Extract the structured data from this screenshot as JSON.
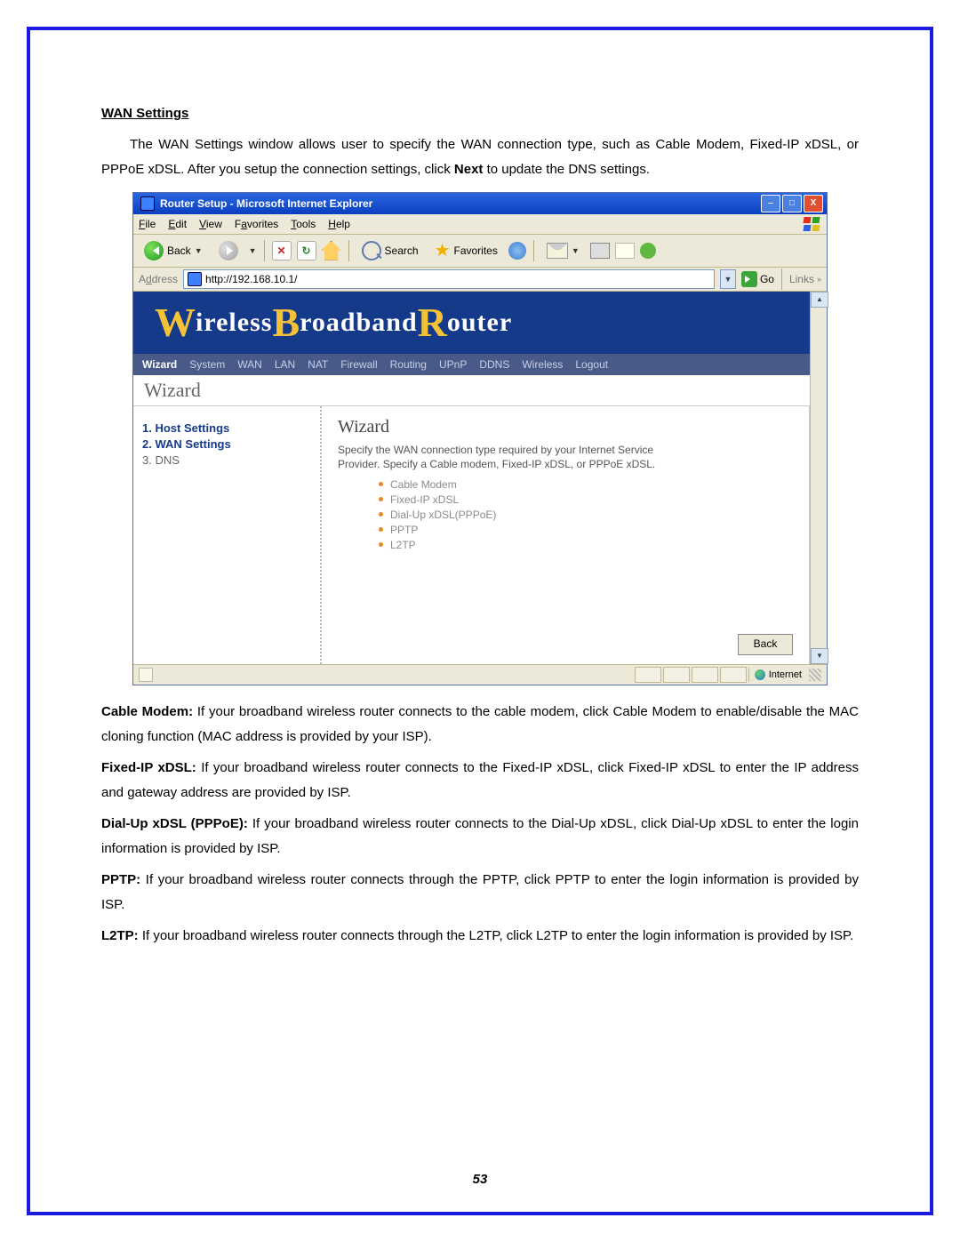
{
  "doc": {
    "section_title": "WAN Settings",
    "intro_1": "The WAN Settings window allows user to specify the WAN connection type, such as Cable Modem, Fixed-IP xDSL, or PPPoE xDSL. After you setup the connection settings, click ",
    "intro_next": "Next",
    "intro_2": " to update the DNS settings.",
    "cable_b": "Cable Modem:",
    "cable_t": " If your broadband wireless router connects to the cable modem, click Cable Modem to enable/disable the MAC cloning function (MAC address is provided by your ISP).",
    "fixed_b": "Fixed-IP xDSL:",
    "fixed_t": " If your broadband wireless router connects to the Fixed-IP xDSL, click Fixed-IP xDSL to enter the IP address and gateway address are provided by ISP.",
    "dial_b": "Dial-Up xDSL (PPPoE):",
    "dial_t": " If your broadband wireless router connects to the Dial-Up xDSL, click Dial-Up xDSL to enter the login information is provided by ISP.",
    "pptp_b": "PPTP:",
    "pptp_t": " If your broadband wireless router connects through the PPTP, click PPTP to enter the login information is provided by ISP.",
    "l2tp_b": "L2TP:",
    "l2tp_t": " If your broadband wireless router connects through the L2TP, click L2TP to enter the login information is provided by ISP.",
    "page_number": "53"
  },
  "ie": {
    "title": "Router Setup - Microsoft Internet Explorer",
    "menu": {
      "file": "File",
      "edit": "Edit",
      "view": "View",
      "favorites": "Favorites",
      "tools": "Tools",
      "help": "Help"
    },
    "tb": {
      "back": "Back",
      "search": "Search",
      "favorites": "Favorites"
    },
    "addr": {
      "label": "Address",
      "url": "http://192.168.10.1/",
      "go": "Go",
      "links": "Links"
    },
    "status": {
      "internet": "Internet"
    }
  },
  "router": {
    "banner": {
      "w": "W",
      "t1": "ireless ",
      "b": "B",
      "t2": "roadband ",
      "r": "R",
      "t3": "outer"
    },
    "nav": [
      "Wizard",
      "System",
      "WAN",
      "LAN",
      "NAT",
      "Firewall",
      "Routing",
      "UPnP",
      "DDNS",
      "Wireless",
      "Logout"
    ],
    "crumb": "Wizard",
    "side": {
      "s1": "1. Host Settings",
      "s2": "2. WAN Settings",
      "s3": "3. DNS"
    },
    "main": {
      "heading": "Wizard",
      "desc": "Specify the WAN connection type required by your Internet Service Provider. Specify a Cable modem, Fixed-IP xDSL, or PPPoE xDSL.",
      "opts": [
        "Cable Modem",
        "Fixed-IP xDSL",
        "Dial-Up xDSL(PPPoE)",
        "PPTP",
        "L2TP"
      ],
      "back": "Back"
    }
  }
}
